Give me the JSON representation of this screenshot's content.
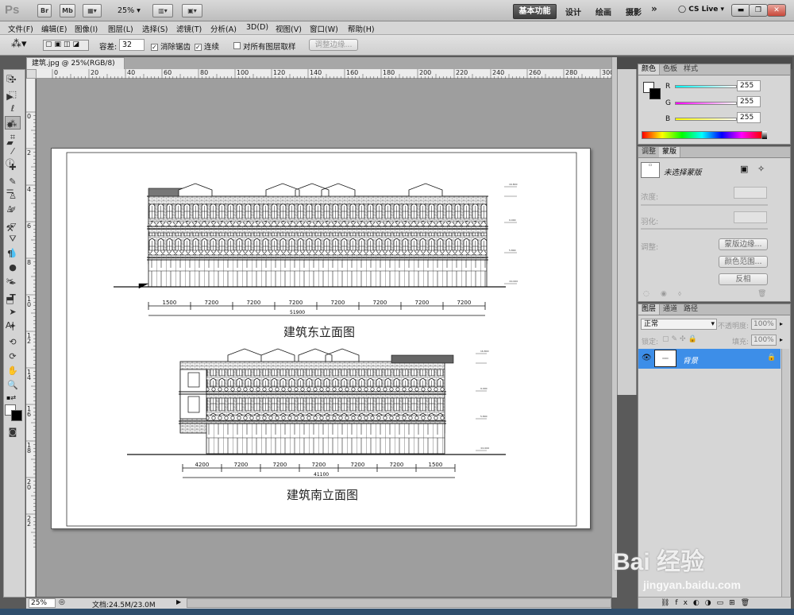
{
  "app": {
    "logo": "Ps",
    "br": "Br",
    "mb": "Mb",
    "zoom": "25%",
    "ws_active": "基本功能",
    "ws": [
      "设计",
      "绘画",
      "摄影"
    ],
    "more": "»",
    "cslive": "CS Live"
  },
  "menu": [
    "文件(F)",
    "编辑(E)",
    "图像(I)",
    "图层(L)",
    "选择(S)",
    "滤镜(T)",
    "分析(A)",
    "3D(D)",
    "视图(V)",
    "窗口(W)",
    "帮助(H)"
  ],
  "options": {
    "tolerance_label": "容差:",
    "tolerance_value": "32",
    "antialias": "消除锯齿",
    "contiguous": "连续",
    "sample_all": "对所有图层取样",
    "refine_edge": "调整边缘..."
  },
  "document": {
    "tab_title": "建筑.jpg @ 25%(RGB/8)",
    "close": "×"
  },
  "ruler": {
    "h_marks": [
      "0",
      "20",
      "40",
      "60",
      "80",
      "100",
      "120",
      "140",
      "160",
      "180",
      "200",
      "220",
      "240",
      "260",
      "280",
      "300"
    ],
    "v_marks": [
      "0",
      "2",
      "4",
      "6",
      "8",
      "1 0",
      "1 2",
      "1 4",
      "1 6",
      "1 8",
      "2 0",
      "2 2"
    ]
  },
  "drawing": {
    "east_title": "建筑东立面图",
    "south_title": "建筑南立面图",
    "east_dims": [
      "1500",
      "7200",
      "7200",
      "7200",
      "7200",
      "7200",
      "7200",
      "7200"
    ],
    "east_total": "51900",
    "south_dims": [
      "4200",
      "7200",
      "7200",
      "7200",
      "7200",
      "7200",
      "1500"
    ],
    "south_total": "41100"
  },
  "status": {
    "zoom": "25%",
    "doc": "文档:24.5M/23.0M"
  },
  "color_panel": {
    "tabs": [
      "颜色",
      "色板",
      "样式"
    ],
    "r_label": "R",
    "g_label": "G",
    "b_label": "B",
    "r": "255",
    "g": "255",
    "b": "255"
  },
  "adjust_panel": {
    "tabs": [
      "调整",
      "蒙版"
    ],
    "no_mask": "未选择蒙版",
    "density": "浓度:",
    "feather": "羽化:",
    "refine": "调整:",
    "mask_edge": "蒙版边缘...",
    "color_range": "颜色范围...",
    "invert": "反相"
  },
  "layers_panel": {
    "tabs": [
      "图层",
      "通道",
      "路径"
    ],
    "blend": "正常",
    "opacity_label": "不透明度:",
    "opacity": "100%",
    "lock_label": "锁定:",
    "fill_label": "填充:",
    "fill": "100%",
    "layer_name": "背景"
  },
  "watermark": {
    "brand": "Bai  经验",
    "url": "jingyan.baidu.com"
  },
  "colors": {
    "accent": "#3c8fe0",
    "selected_layer": "#3d8ee8"
  }
}
